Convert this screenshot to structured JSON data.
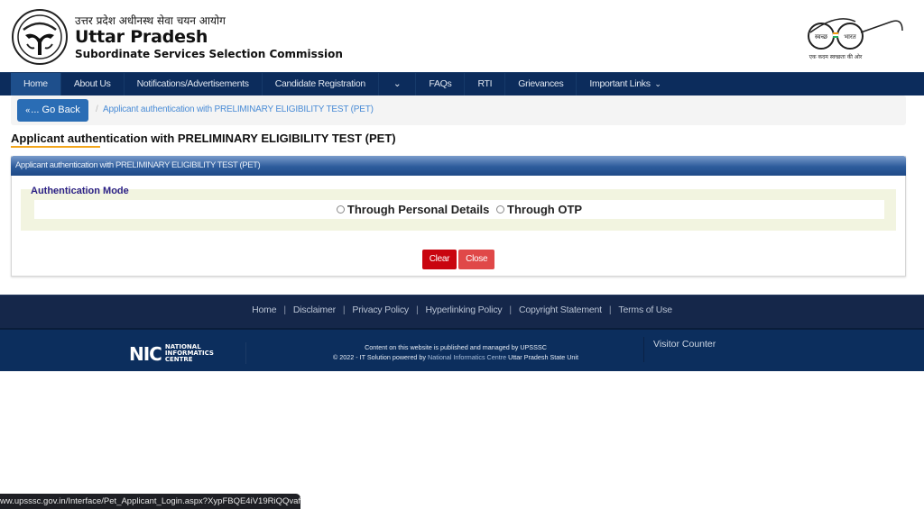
{
  "header": {
    "hindi_title": "उत्तर प्रदेश अधीनस्थ सेवा चयन आयोग",
    "title": "Uttar Pradesh",
    "subtitle": "Subordinate Services Selection Commission",
    "swachh_left": "स्वच्छ",
    "swachh_right": "भारत",
    "swachh_tagline": "एक कदम स्वच्छता की ओर"
  },
  "nav": {
    "items": [
      {
        "label": "Home",
        "active": true
      },
      {
        "label": "About Us"
      },
      {
        "label": "Notifications/Advertisements"
      },
      {
        "label": "Candidate Registration"
      },
      {
        "label": "⌄"
      },
      {
        "label": "FAQs"
      },
      {
        "label": "RTI"
      },
      {
        "label": "Grievances"
      },
      {
        "label": "Important Links",
        "caret": "⌄"
      }
    ]
  },
  "breadcrumb": {
    "back_icon": "«",
    "back_label": "... Go Back",
    "separator": "/",
    "current": "Applicant authentication with PRELIMINARY ELIGIBILITY TEST (PET)"
  },
  "page": {
    "title": "Applicant authentication with PRELIMINARY ELIGIBILITY TEST (PET)",
    "accent_color": "#f2a51c"
  },
  "panel": {
    "heading": "Applicant authentication with PRELIMINARY ELIGIBILITY TEST (PET)",
    "legend": "Authentication Mode",
    "options": [
      {
        "label": "Through Personal Details",
        "selected": false
      },
      {
        "label": "Through OTP",
        "selected": false
      }
    ],
    "buttons": {
      "clear": "Clear",
      "close": "Close"
    }
  },
  "footer": {
    "links": [
      "Home",
      "Disclaimer",
      "Privacy Policy",
      "Hyperlinking Policy",
      "Copyright Statement",
      "Terms of Use"
    ],
    "nic_mark": "NIC",
    "nic_line1": "NATIONAL",
    "nic_line2": "INFORMATICS",
    "nic_line3": "CENTRE",
    "credit_line1": "Content on this website is published and managed by UPSSSC",
    "credit_line2_prefix": "© 2022 - IT Solution powered by ",
    "credit_line2_link": "National Informatics Centre",
    "credit_line2_suffix": " Uttar Pradesh State Unit",
    "visitor_counter": "Visitor Counter"
  },
  "statusbar": {
    "url": "ww.upsssc.gov.in/Interface/Pet_Applicant_Login.aspx?XypFBQE4iV19RiQQvaf..."
  }
}
